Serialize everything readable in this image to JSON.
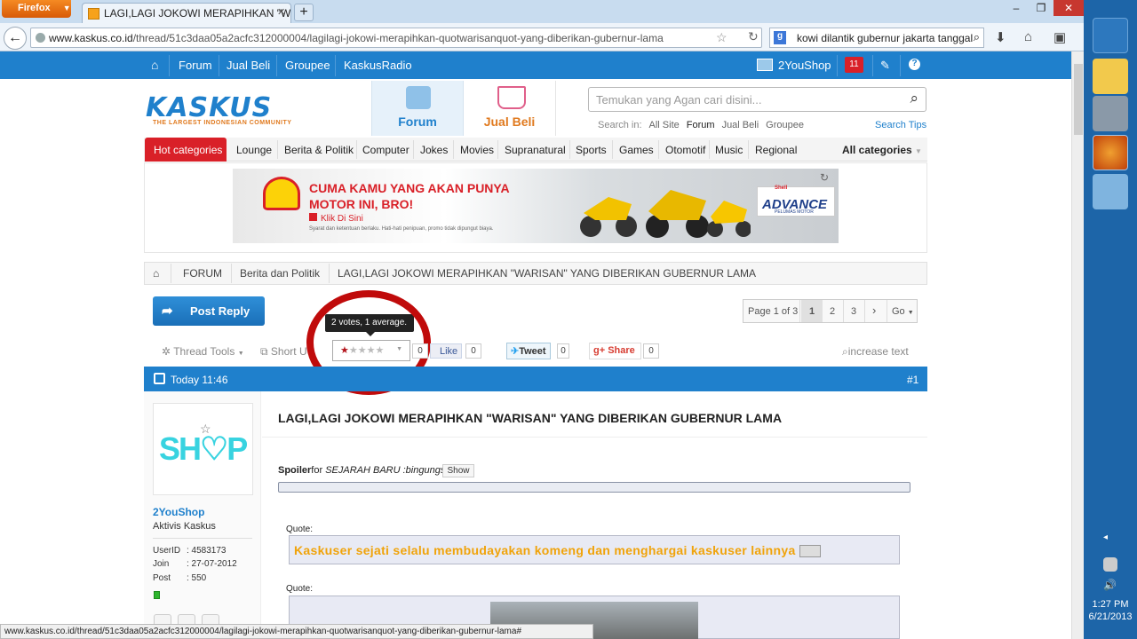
{
  "browser": {
    "app_button": "Firefox",
    "tab_title": "LAGI,LAGI JOKOWI MERAPIHKAN \"WARI...",
    "url_domain": "www.kaskus.co.id",
    "url_path": "/thread/51c3daa05a2acfc312000004/lagilagi-jokowi-merapihkan-quotwarisanquot-yang-diberikan-gubernur-lama",
    "search_value": "kowi dilantik gubernur jakarta tanggal",
    "status_url": "www.kaskus.co.id/thread/51c3daa05a2acfc312000004/lagilagi-jokowi-merapihkan-quotwarisanquot-yang-diberikan-gubernur-lama#"
  },
  "topnav": {
    "items": [
      "Forum",
      "Jual Beli",
      "Groupee",
      "KaskusRadio"
    ],
    "username": "2YouShop",
    "notif_count": "11"
  },
  "header": {
    "logo": "KASKUS",
    "logo_tagline": "THE LARGEST INDONESIAN COMMUNITY",
    "tab_forum": "Forum",
    "tab_jualbeli": "Jual Beli",
    "search_placeholder": "Temukan yang Agan cari disini...",
    "search_in_label": "Search in:",
    "search_in": [
      "All Site",
      "Forum",
      "Jual Beli",
      "Groupee"
    ],
    "search_tips": "Search Tips"
  },
  "categories": {
    "hot": "Hot categories",
    "items": [
      "Lounge",
      "Berita & Politik",
      "Computer",
      "Jokes",
      "Movies",
      "Supranatural",
      "Sports",
      "Games",
      "Otomotif",
      "Music",
      "Regional"
    ],
    "all": "All categories"
  },
  "banner": {
    "headline1": "CUMA KAMU YANG AKAN PUNYA",
    "headline2": "MOTOR INI, BRO!",
    "cta": "Klik Di Sini",
    "fineprint": "Syarat dan ketentuan berlaku. Hati-hati penipuan, promo tidak dipungut biaya.",
    "brand_small": "Shell",
    "brand": "ADVANCE",
    "brand_sub": "PELUMAS MOTOR"
  },
  "breadcrumb": [
    "FORUM",
    "Berita dan Politik",
    "LAGI,LAGI JOKOWI MERAPIHKAN \"WARISAN\" YANG DIBERIKAN GUBERNUR LAMA"
  ],
  "thread_tools": {
    "post_reply": "Post Reply",
    "pager_label": "Page 1 of 3",
    "pages": [
      "1",
      "2",
      "3"
    ],
    "next": "›",
    "go": "Go",
    "rating_tooltip": "2 votes, 1 average.",
    "rating_value": 1,
    "rating_max": 5,
    "thread_tools": "Thread Tools",
    "short_url": "Short U",
    "like": "Like",
    "like_count": "0",
    "like_count_left": "0",
    "tweet": "Tweet",
    "tweet_count": "0",
    "share": "Share",
    "share_count": "0",
    "increase_text": "increase text"
  },
  "post": {
    "time": "Today 11:46",
    "number": "#1",
    "title": "LAGI,LAGI JOKOWI MERAPIHKAN \"WARISAN\" YANG DIBERIKAN GUBERNUR LAMA",
    "spoiler_label": "Spoiler",
    "spoiler_for": "for",
    "spoiler_topic": "SEJARAH BARU :bingungs:",
    "show_button": "Show",
    "quote_label": "Quote:",
    "quote1_text": "Kaskuser sejati selalu membudayakan komeng dan menghargai kaskuser lainnya",
    "quote2_label": "Quote:"
  },
  "user": {
    "avatar_text": "SH♡P",
    "name": "2YouShop",
    "rank": "Aktivis Kaskus",
    "userid_label": "UserID",
    "userid": ": 4583173",
    "join_label": "Join",
    "join": ": 27-07-2012",
    "post_label": "Post",
    "post": ": 550"
  },
  "taskbar": {
    "time": "1:27 PM",
    "date": "6/21/2013"
  },
  "colors": {
    "kaskus_blue": "#1f80cc",
    "hot_red": "#d92028",
    "highlight_circle": "#c00b0b",
    "quote_orange": "#f0a30a"
  }
}
